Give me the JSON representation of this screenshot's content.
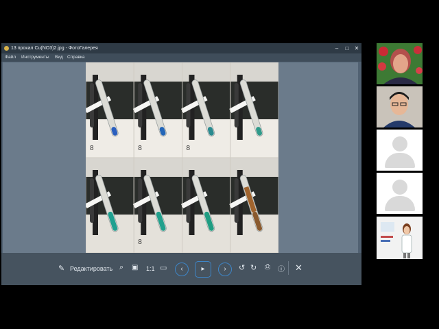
{
  "window": {
    "title": "13 прокал Cu(NO3)2.jpg - ФотоГалерея",
    "controls": [
      "–",
      "□",
      "✕"
    ]
  },
  "menu": [
    "Файл",
    "Инструменты",
    "Вид",
    "Справка"
  ],
  "toolbar": {
    "edit_label": "Редактировать",
    "zoom_label": "1:1"
  },
  "photo": {
    "tube_liquids_top": [
      "#2a5fbf",
      "#2466b8",
      "#2a8a8f",
      "#2f9a8a"
    ],
    "tube_liquids_bottom": [
      "#1fa090",
      "#21a08c",
      "#1f9d82",
      "#8a5a2e"
    ],
    "tube_labels": [
      "8",
      "8",
      "8",
      "",
      "",
      "8",
      "",
      ""
    ]
  },
  "participants": [
    {
      "icon": "participant-video-1"
    },
    {
      "icon": "participant-video-2"
    },
    {
      "icon": "avatar-placeholder"
    },
    {
      "icon": "avatar-placeholder"
    },
    {
      "icon": "participant-video-3"
    }
  ],
  "colors": {
    "accent": "#3e86c8",
    "close_red": "#e0433f"
  }
}
